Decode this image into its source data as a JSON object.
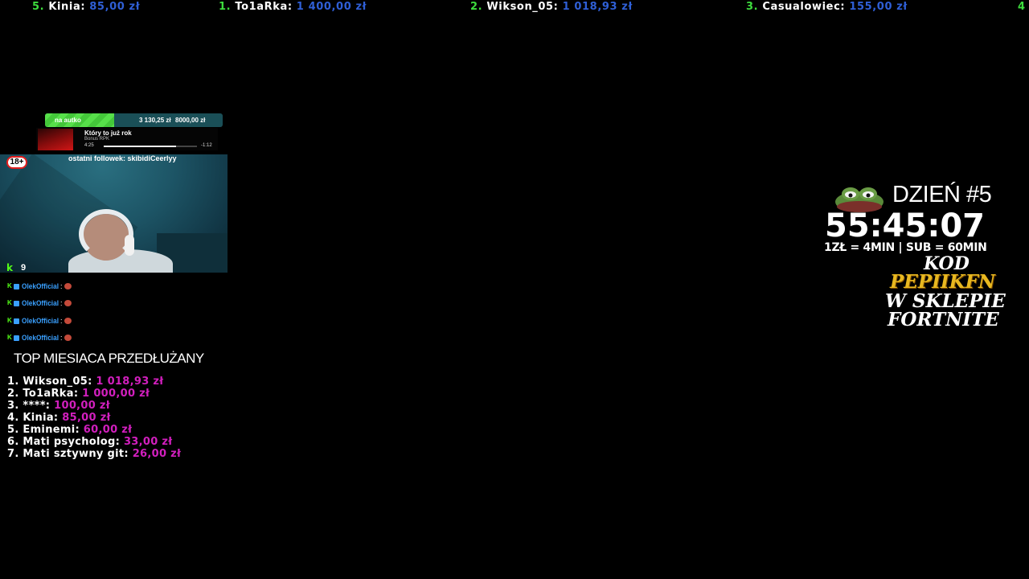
{
  "ticker": [
    {
      "rank": "5.",
      "name": "Kinia:",
      "amount": "85,00 zł"
    },
    {
      "rank": "1.",
      "name": "To1aRka:",
      "amount": "1 400,00 zł"
    },
    {
      "rank": "2.",
      "name": "Wikson_05:",
      "amount": "1 018,93 zł"
    },
    {
      "rank": "3.",
      "name": "Casualowiec:",
      "amount": "155,00 zł"
    },
    {
      "rank": "4",
      "name": "",
      "amount": ""
    }
  ],
  "goal": {
    "label": "na autko",
    "current": "3 130,25 zł",
    "target": "8000,00 zł",
    "progress_fraction": 0.39
  },
  "music": {
    "title": "Który to już rok",
    "artist": "Bonus RPK",
    "elapsed": "4:25",
    "remaining": "-1:12",
    "progress_fraction": 0.78
  },
  "stream": {
    "age_badge": "18+",
    "last_follower": "ostatni followek: skibidiCeerlyy",
    "viewer_icon": "k",
    "viewer_count": "9"
  },
  "chat": [
    {
      "user": "OlekOfficial",
      "sep": ":"
    },
    {
      "user": "OlekOfficial",
      "sep": ":"
    },
    {
      "user": "OlekOfficial",
      "sep": ":"
    },
    {
      "user": "OlekOfficial",
      "sep": ":"
    }
  ],
  "board": {
    "title": "TOP MIESIACA PRZEDŁUŻANY",
    "rows": [
      {
        "name": "1. Wikson_05:",
        "amount": "1 018,93 zł"
      },
      {
        "name": "2. To1aRka:",
        "amount": "1 000,00 zł"
      },
      {
        "name": "3. ****:",
        "amount": "100,00 zł"
      },
      {
        "name": "4. Kinia:",
        "amount": "85,00 zł"
      },
      {
        "name": "5. Eminemi:",
        "amount": "60,00 zł"
      },
      {
        "name": "6. Mati psycholog:",
        "amount": "33,00 zł"
      },
      {
        "name": "7. Mati sztywny git:",
        "amount": "26,00 zł"
      }
    ]
  },
  "subathon": {
    "day": "DZIEŃ #5",
    "timer": "55:45:07",
    "rate": "1ZŁ = 4MIN | SUB = 60MIN",
    "code_line1": "KOD",
    "code_line2": "PEPIIKFN",
    "code_line3": "W SKLEPIE",
    "code_line4": "FORTNITE"
  },
  "colors": {
    "ticker_rank": "#3ddc3d",
    "ticker_amount": "#2f5fd6",
    "board_amount": "#d21fbe",
    "goal_fill": "#57e04a",
    "chat_user": "#3aa0ff",
    "code_gold": "#e8b820"
  }
}
